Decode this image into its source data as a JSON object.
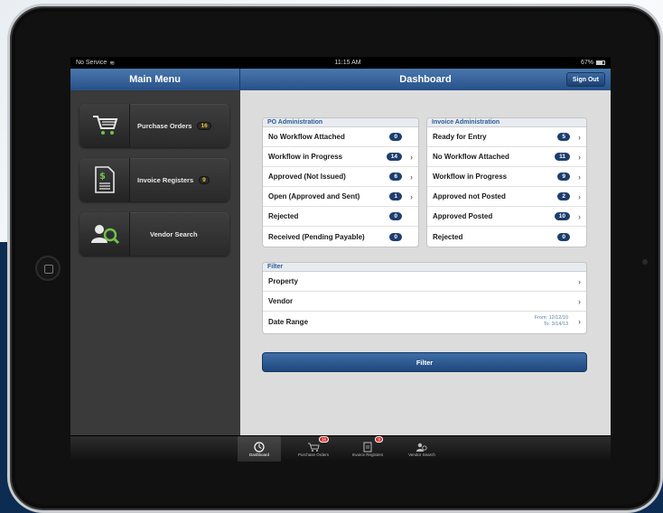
{
  "status": {
    "carrier": "No Service",
    "time": "11:15 AM",
    "battery": "67%"
  },
  "sidebar": {
    "title": "Main Menu",
    "items": [
      {
        "label": "Purchase Orders",
        "badge": "16",
        "icon": "cart-icon"
      },
      {
        "label": "Invoice Registers",
        "badge": "9",
        "icon": "invoice-icon"
      },
      {
        "label": "Vendor Search",
        "badge": "",
        "icon": "vendor-search-icon"
      }
    ]
  },
  "header": {
    "title": "Dashboard",
    "sign_out": "Sign Out"
  },
  "po_admin": {
    "title": "PO Administration",
    "rows": [
      {
        "label": "No Workflow Attached",
        "count": "0",
        "chevron": false
      },
      {
        "label": "Workflow in Progress",
        "count": "14",
        "chevron": true
      },
      {
        "label": "Approved (Not Issued)",
        "count": "6",
        "chevron": true
      },
      {
        "label": "Open (Approved and Sent)",
        "count": "1",
        "chevron": true
      },
      {
        "label": "Rejected",
        "count": "0",
        "chevron": false
      },
      {
        "label": "Received (Pending Payable)",
        "count": "0",
        "chevron": false
      }
    ]
  },
  "invoice_admin": {
    "title": "Invoice Administration",
    "rows": [
      {
        "label": "Ready for Entry",
        "count": "5",
        "chevron": true
      },
      {
        "label": "No Workflow Attached",
        "count": "11",
        "chevron": true
      },
      {
        "label": "Workflow in Progress",
        "count": "9",
        "chevron": true
      },
      {
        "label": "Approved not Posted",
        "count": "2",
        "chevron": true
      },
      {
        "label": "Approved Posted",
        "count": "10",
        "chevron": true
      },
      {
        "label": "Rejected",
        "count": "0",
        "chevron": false
      }
    ]
  },
  "filter": {
    "title": "Filter",
    "property": "Property",
    "vendor": "Vendor",
    "date_range": "Date Range",
    "from": "From: 12/12/10",
    "to": "To: 3/14/13",
    "button": "Filter"
  },
  "tabs": [
    {
      "label": "Dashboard",
      "badge": "",
      "active": true
    },
    {
      "label": "Purchase Orders",
      "badge": "16",
      "active": false
    },
    {
      "label": "Invoice Registers",
      "badge": "9",
      "active": false
    },
    {
      "label": "Vendor Search",
      "badge": "",
      "active": false
    }
  ],
  "colors": {
    "accent": "#275089",
    "badge": "#1d3e6d",
    "alert": "#d42a2a"
  }
}
